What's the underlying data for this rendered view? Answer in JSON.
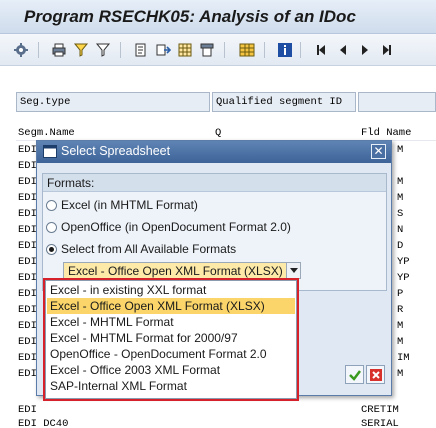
{
  "window": {
    "title": "Program RSECHK05: Analysis of an IDoc"
  },
  "toolbar": {
    "buttons": [
      {
        "icon": "settings-icon"
      },
      {
        "icon": "print-icon"
      },
      {
        "icon": "filter-icon"
      },
      {
        "icon": "set-filter-icon"
      },
      {
        "icon": "export-icon"
      },
      {
        "icon": "local-file-icon"
      },
      {
        "icon": "spreadsheet-icon"
      },
      {
        "icon": "word-processing-icon"
      },
      {
        "icon": "layout-icon"
      },
      {
        "icon": "info-icon"
      },
      {
        "icon": "first-page-icon"
      },
      {
        "icon": "previous-page-icon"
      },
      {
        "icon": "next-page-icon"
      },
      {
        "icon": "last-page-icon"
      }
    ]
  },
  "list": {
    "headers": [
      "Seg.type",
      "Qualified segment ID"
    ],
    "row1": {
      "c1": "Segm.Name",
      "c2": "Q",
      "c3": "Fld Name"
    },
    "left_cells": [
      "EDI",
      "EDI",
      "EDI",
      "EDI",
      "EDI",
      "EDI",
      "EDI",
      "EDI",
      "EDI",
      "EDI",
      "EDI",
      "EDI",
      "EDI",
      "EDI",
      "EDI"
    ],
    "right_cells": [
      "M",
      "",
      "M",
      "M",
      "S",
      "N",
      "D",
      "YP",
      "YP",
      "P",
      "R",
      "M",
      "M",
      "IM",
      "M"
    ],
    "bottom_rows": [
      {
        "c1": "EDI",
        "c3": "CRETIM"
      },
      {
        "c1": "EDI DC40",
        "c3": "SERIAL"
      }
    ]
  },
  "dialog": {
    "title": "Select Spreadsheet",
    "group_title": "Formats:",
    "options": [
      {
        "label": "Excel (in MHTML Format)",
        "checked": false
      },
      {
        "label": "OpenOffice (in OpenDocument Format 2.0)",
        "checked": false
      },
      {
        "label": "Select from All Available Formats",
        "checked": true
      }
    ],
    "selected_format": "Excel - Office Open XML Format (XLSX)",
    "ok_icon": "checkmark-icon",
    "cancel_icon": "cancel-x-icon"
  },
  "dropdown": {
    "items": [
      {
        "label": "Excel -  in existing XXL format",
        "selected": false
      },
      {
        "label": "Excel - Office Open XML Format (XLSX)",
        "selected": true
      },
      {
        "label": "Excel - MHTML Format",
        "selected": false
      },
      {
        "label": "Excel - MHTML Format for 2000/97",
        "selected": false
      },
      {
        "label": "OpenOffice - OpenDocument Format 2.0",
        "selected": false
      },
      {
        "label": "Excel - Office 2003 XML Format",
        "selected": false
      },
      {
        "label": "SAP-Internal XML Format",
        "selected": false
      }
    ]
  },
  "colors": {
    "highlight": "#fbd56a",
    "callout_border": "#d6202a",
    "dialog_title": "#3d6398"
  }
}
